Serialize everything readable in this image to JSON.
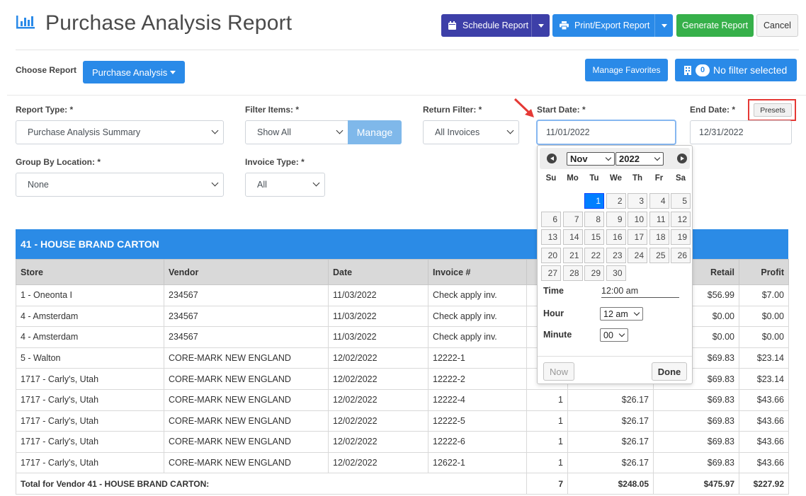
{
  "header": {
    "title": "Purchase Analysis Report",
    "schedule_label": "Schedule Report",
    "print_label": "Print/Export Report",
    "generate_label": "Generate Report",
    "cancel_label": "Cancel"
  },
  "toolbar": {
    "choose_report_label": "Choose Report",
    "choose_report_value": "Purchase Analysis",
    "manage_favorites_label": "Manage Favorites",
    "filter_count": "0",
    "filter_status": "No filter selected"
  },
  "filters": {
    "report_type_label": "Report Type: *",
    "report_type_value": "Purchase Analysis Summary",
    "filter_items_label": "Filter Items: *",
    "filter_items_value": "Show All",
    "manage_label": "Manage",
    "return_filter_label": "Return Filter: *",
    "return_filter_value": "All Invoices",
    "start_date_label": "Start Date: *",
    "start_date_value": "11/01/2022",
    "end_date_label": "End Date: *",
    "end_date_value": "12/31/2022",
    "presets_label": "Presets",
    "group_by_label": "Group By Location: *",
    "group_by_value": "None",
    "invoice_type_label": "Invoice Type: *",
    "invoice_type_value": "All"
  },
  "datepicker": {
    "month": "Nov",
    "year": "2022",
    "weekdays": [
      "Su",
      "Mo",
      "Tu",
      "We",
      "Th",
      "Fr",
      "Sa"
    ],
    "days": [
      "1",
      "2",
      "3",
      "4",
      "5",
      "6",
      "7",
      "8",
      "9",
      "10",
      "11",
      "12",
      "13",
      "14",
      "15",
      "16",
      "17",
      "18",
      "19",
      "20",
      "21",
      "22",
      "23",
      "24",
      "25",
      "26",
      "27",
      "28",
      "29",
      "30"
    ],
    "selected_day": "1",
    "time_label": "Time",
    "time_value": "12:00 am",
    "hour_label": "Hour",
    "hour_value": "12 am",
    "minute_label": "Minute",
    "minute_value": "00",
    "now_label": "Now",
    "done_label": "Done"
  },
  "report": {
    "group_title": "41 - HOUSE BRAND CARTON",
    "columns": [
      "Store",
      "Vendor",
      "Date",
      "Invoice #",
      "",
      "",
      "Retail",
      "Profit"
    ],
    "rows": [
      [
        "1 - Oneonta I",
        "234567",
        "11/03/2022",
        "Check apply inv.",
        "",
        "",
        "$56.99",
        "$7.00"
      ],
      [
        "4 - Amsterdam",
        "234567",
        "11/03/2022",
        "Check apply inv.",
        "",
        "",
        "$0.00",
        "$0.00"
      ],
      [
        "4 - Amsterdam",
        "234567",
        "11/03/2022",
        "Check apply inv.",
        "",
        "",
        "$0.00",
        "$0.00"
      ],
      [
        "5 - Walton",
        "CORE-MARK NEW ENGLAND",
        "12/02/2022",
        "12222-1",
        "",
        "",
        "$69.83",
        "$23.14"
      ],
      [
        "1717 - Carly's, Utah",
        "CORE-MARK NEW ENGLAND",
        "12/02/2022",
        "12222-2",
        "",
        "",
        "$69.83",
        "$23.14"
      ],
      [
        "1717 - Carly's, Utah",
        "CORE-MARK NEW ENGLAND",
        "12/02/2022",
        "12222-4",
        "1",
        "$26.17",
        "$69.83",
        "$43.66"
      ],
      [
        "1717 - Carly's, Utah",
        "CORE-MARK NEW ENGLAND",
        "12/02/2022",
        "12222-5",
        "1",
        "$26.17",
        "$69.83",
        "$43.66"
      ],
      [
        "1717 - Carly's, Utah",
        "CORE-MARK NEW ENGLAND",
        "12/02/2022",
        "12222-6",
        "1",
        "$26.17",
        "$69.83",
        "$43.66"
      ],
      [
        "1717 - Carly's, Utah",
        "CORE-MARK NEW ENGLAND",
        "12/02/2022",
        "12622-1",
        "1",
        "$26.17",
        "$69.83",
        "$43.66"
      ]
    ],
    "total_label": "Total for Vendor 41 - HOUSE BRAND CARTON:",
    "total_qty": "7",
    "total_cost": "$248.05",
    "total_retail": "$475.97",
    "total_profit": "$227.92"
  },
  "colors": {
    "accent_blue": "#2a8ae8",
    "schedule_purple": "#3d3fa8",
    "generate_green": "#36b04a",
    "highlight_red": "#e53935"
  },
  "icons": [
    "bar-chart-icon",
    "calendar-icon",
    "printer-icon",
    "building-icon",
    "red-arrow-annotation"
  ]
}
